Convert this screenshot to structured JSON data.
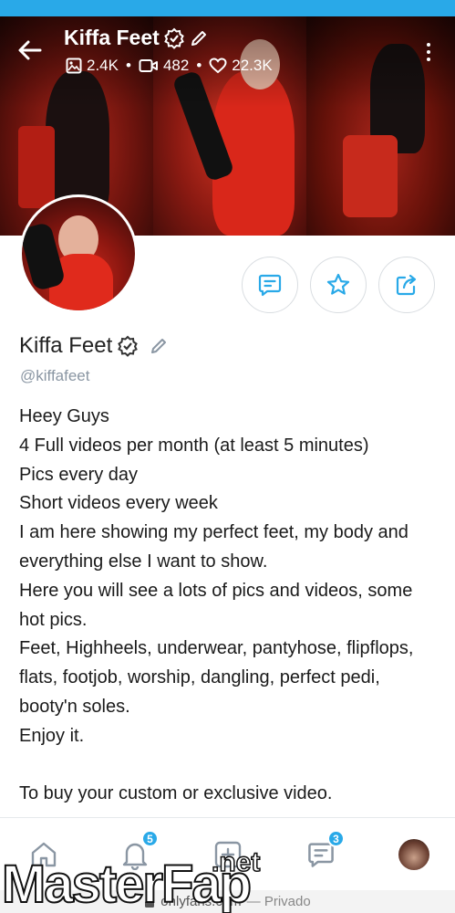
{
  "header": {
    "title": "Kiffa Feet",
    "stats": [
      {
        "icon": "image-icon",
        "value": "2.4K"
      },
      {
        "icon": "video-icon",
        "value": "482"
      },
      {
        "icon": "heart-icon",
        "value": "22.3K"
      }
    ],
    "separator": "•"
  },
  "profile": {
    "name": "Kiffa Feet",
    "handle": "@kiffafeet",
    "bio_lines": [
      "Heey Guys",
      "4 Full videos per month (at least 5 minutes)",
      "Pics every day",
      "Short videos every week",
      "I am here showing my perfect feet, my body and",
      "everything else I want to show.",
      "Here you will see a lots of pics and videos, some",
      "hot pics.",
      "Feet, Highheels, underwear, pantyhose, flipflops,",
      "flats, footjob, worship, dangling, perfect pedi,",
      "booty'n soles.",
      "Enjoy it.",
      "",
      "To buy your custom or exclusive video."
    ]
  },
  "actions": [
    {
      "name": "message-button",
      "icon": "message-icon"
    },
    {
      "name": "favorite-button",
      "icon": "star-icon"
    },
    {
      "name": "share-button",
      "icon": "share-icon"
    }
  ],
  "bottom_nav": {
    "items": [
      {
        "name": "home",
        "icon": "home-icon",
        "badge": ""
      },
      {
        "name": "notifications",
        "icon": "bell-icon",
        "badge": "5"
      },
      {
        "name": "add-post",
        "icon": "plus-square-icon",
        "badge": ""
      },
      {
        "name": "messages",
        "icon": "chat-icon",
        "badge": "3"
      },
      {
        "name": "profile",
        "icon": "avatar",
        "badge": ""
      }
    ]
  },
  "browser": {
    "url": "onlyfans.com",
    "mode": "— Privado"
  },
  "watermark": {
    "text_main": "MasterFap",
    "text_suffix": ".net"
  },
  "colors": {
    "accent": "#29a9e8",
    "text_muted": "#8a96a3",
    "cover_red": "#c62a1c"
  }
}
